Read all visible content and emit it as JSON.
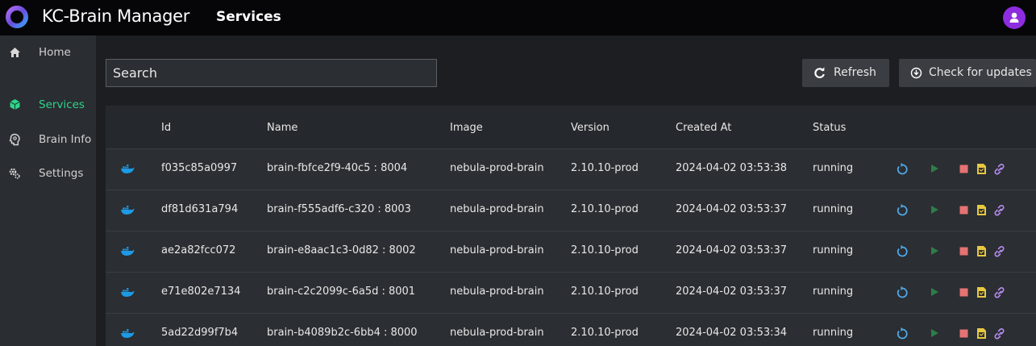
{
  "app": {
    "title": "KC-Brain Manager",
    "page_heading": "Services"
  },
  "icons": {
    "logo": "kc-brain-ring-logo",
    "user": "user-avatar-icon",
    "home": "home-icon",
    "services": "cube-icon",
    "brain_info": "brain-head-icon",
    "settings": "gear-icon",
    "refresh": "refresh-icon",
    "updates": "download-circle-icon",
    "row_type": "docker-whale-icon",
    "restart": "restart-icon",
    "start": "play-icon",
    "stop": "stop-icon",
    "logs": "log-file-icon",
    "link": "link-icon"
  },
  "colors": {
    "accent_green": "#2ed48a",
    "avatar_purple": "#8e2ce0",
    "restart_blue": "#4fa8e8",
    "play_green": "#2e7d4a",
    "stop_red": "#e57373",
    "logs_yellow": "#e8c840",
    "link_purple": "#b58bf0",
    "docker_blue": "#1d9ae6"
  },
  "sidebar": {
    "items": [
      {
        "label": "Home",
        "active": false
      },
      {
        "label": "Services",
        "active": true
      },
      {
        "label": "Brain Info",
        "active": false
      },
      {
        "label": "Settings",
        "active": false
      }
    ]
  },
  "toolbar": {
    "search_placeholder": "Search",
    "refresh_label": "Refresh",
    "updates_label": "Check for updates"
  },
  "table": {
    "columns": [
      "Id",
      "Name",
      "Image",
      "Version",
      "Created At",
      "Status"
    ],
    "rows": [
      {
        "id": "f035c85a0997",
        "name": "brain-fbfce2f9-40c5 : 8004",
        "image": "nebula-prod-brain",
        "version": "2.10.10-prod",
        "created": "2024-04-02 03:53:38",
        "status": "running"
      },
      {
        "id": "df81d631a794",
        "name": "brain-f555adf6-c320 : 8003",
        "image": "nebula-prod-brain",
        "version": "2.10.10-prod",
        "created": "2024-04-02 03:53:37",
        "status": "running"
      },
      {
        "id": "ae2a82fcc072",
        "name": "brain-e8aac1c3-0d82 : 8002",
        "image": "nebula-prod-brain",
        "version": "2.10.10-prod",
        "created": "2024-04-02 03:53:37",
        "status": "running"
      },
      {
        "id": "e71e802e7134",
        "name": "brain-c2c2099c-6a5d : 8001",
        "image": "nebula-prod-brain",
        "version": "2.10.10-prod",
        "created": "2024-04-02 03:53:37",
        "status": "running"
      },
      {
        "id": "5ad22d99f7b4",
        "name": "brain-b4089b2c-6bb4 : 8000",
        "image": "nebula-prod-brain",
        "version": "2.10.10-prod",
        "created": "2024-04-02 03:53:34",
        "status": "running"
      }
    ]
  }
}
